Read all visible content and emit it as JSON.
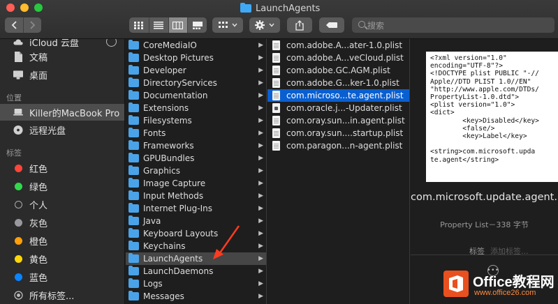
{
  "window": {
    "title": "LaunchAgents"
  },
  "toolbar": {
    "back_icon": "chevron-left-icon",
    "forward_icon": "chevron-right-icon",
    "search_placeholder": "搜索"
  },
  "sidebar": {
    "top_items": [
      {
        "label": "iCloud 云盘",
        "icon": "cloud-icon"
      },
      {
        "label": "文稿",
        "icon": "document-icon"
      },
      {
        "label": "桌面",
        "icon": "desktop-icon"
      }
    ],
    "locations_header": "位置",
    "locations": [
      {
        "label": "Killer的MacBook Pro",
        "icon": "laptop-icon",
        "selected": true
      },
      {
        "label": "远程光盘",
        "icon": "disc-icon"
      }
    ],
    "tags_header": "标签",
    "tags": [
      {
        "label": "红色",
        "color": "#ff453a"
      },
      {
        "label": "绿色",
        "color": "#32d74b"
      },
      {
        "label": "个人",
        "color": "hollow"
      },
      {
        "label": "灰色",
        "color": "#98989d"
      },
      {
        "label": "橙色",
        "color": "#ff9f0a"
      },
      {
        "label": "黄色",
        "color": "#ffd60a"
      },
      {
        "label": "蓝色",
        "color": "#0a84ff"
      },
      {
        "label": "所有标签...",
        "color": "all"
      }
    ]
  },
  "column1": {
    "items": [
      "CoreMediaIO",
      "Desktop Pictures",
      "Developer",
      "DirectoryServices",
      "Documentation",
      "Extensions",
      "Filesystems",
      "Fonts",
      "Frameworks",
      "GPUBundles",
      "Graphics",
      "Image Capture",
      "Input Methods",
      "Internet Plug-Ins",
      "Java",
      "Keyboard Layouts",
      "Keychains",
      "LaunchAgents",
      "LaunchDaemons",
      "Logs",
      "Messages"
    ],
    "selected": "LaunchAgents"
  },
  "column2": {
    "items": [
      {
        "name": "com.adobe.A...ater-1.0.plist",
        "kind": "doc"
      },
      {
        "name": "com.adobe.A...veCloud.plist",
        "kind": "doc"
      },
      {
        "name": "com.adobe.GC.AGM.plist",
        "kind": "doc"
      },
      {
        "name": "com.adobe.G...ker-1.0.plist",
        "kind": "doc"
      },
      {
        "name": "com.microso...te.agent.plist",
        "kind": "doc",
        "selected": true
      },
      {
        "name": "com.oracle.j...-Updater.plist",
        "kind": "jar"
      },
      {
        "name": "com.oray.sun...in.agent.plist",
        "kind": "doc"
      },
      {
        "name": "com.oray.sun....startup.plist",
        "kind": "doc"
      },
      {
        "name": "com.paragon...n-agent.plist",
        "kind": "doc"
      }
    ]
  },
  "preview": {
    "content": "<?xml version=\"1.0\"\nencoding=\"UTF-8\"?>\n<!DOCTYPE plist PUBLIC \"-//\nApple//DTD PLIST 1.0//EN\"\n\"http://www.apple.com/DTDs/\nPropertyList-1.0.dtd\">\n<plist version=\"1.0\">\n<dict>\n        <key>Disabled</key>\n        <false/>\n        <key>Label</key>\n\n<string>com.microsoft.upda\nte.agent</string>",
    "title": "com.microsoft.update.agent.plist",
    "subtitle": "Property List－338 字节",
    "tags_label": "标签",
    "tags_placeholder": "添加标签..."
  },
  "watermark": {
    "brand": "Office教程网",
    "url": "www.office26.com"
  }
}
